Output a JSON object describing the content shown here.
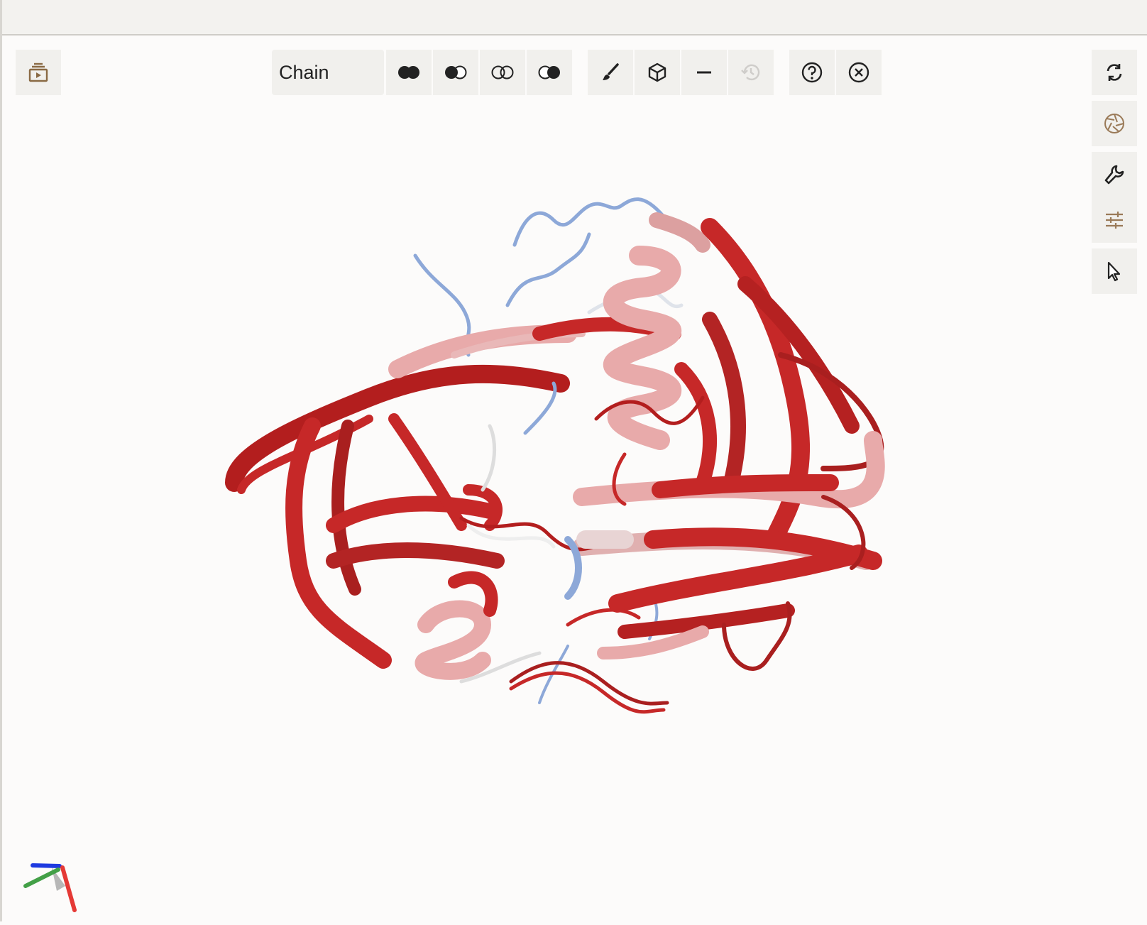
{
  "window": {
    "title": ""
  },
  "toolbar": {
    "color_theme_select": {
      "value": "Chain"
    },
    "left_button_icon": "animation-panel-icon",
    "buttons": [
      {
        "icon": "overlap-full-icon"
      },
      {
        "icon": "overlap-left-icon"
      },
      {
        "icon": "overlap-none-icon"
      },
      {
        "icon": "overlap-right-icon"
      },
      {
        "icon": "brush-icon"
      },
      {
        "icon": "cube-icon"
      },
      {
        "icon": "minus-icon"
      },
      {
        "icon": "history-icon"
      },
      {
        "icon": "help-icon"
      },
      {
        "icon": "close-circle-icon"
      }
    ]
  },
  "right_panel": {
    "buttons": [
      {
        "icon": "rotate-icon"
      },
      {
        "icon": "camera-shutter-icon"
      },
      {
        "icon": "wrench-icon"
      },
      {
        "icon": "sliders-icon"
      },
      {
        "icon": "cursor-icon"
      }
    ]
  },
  "viewer": {
    "content": "protein-structure-cartoon",
    "colors": {
      "red": "#c62828",
      "dark_red": "#9e1b1b",
      "pink": "#e8aaaa",
      "white": "#eeeeee",
      "blue": "#8da8d8"
    }
  },
  "axes_gizmo": {
    "x_color": "#e53935",
    "y_color": "#43a047",
    "z_color": "#1e3ae0"
  }
}
